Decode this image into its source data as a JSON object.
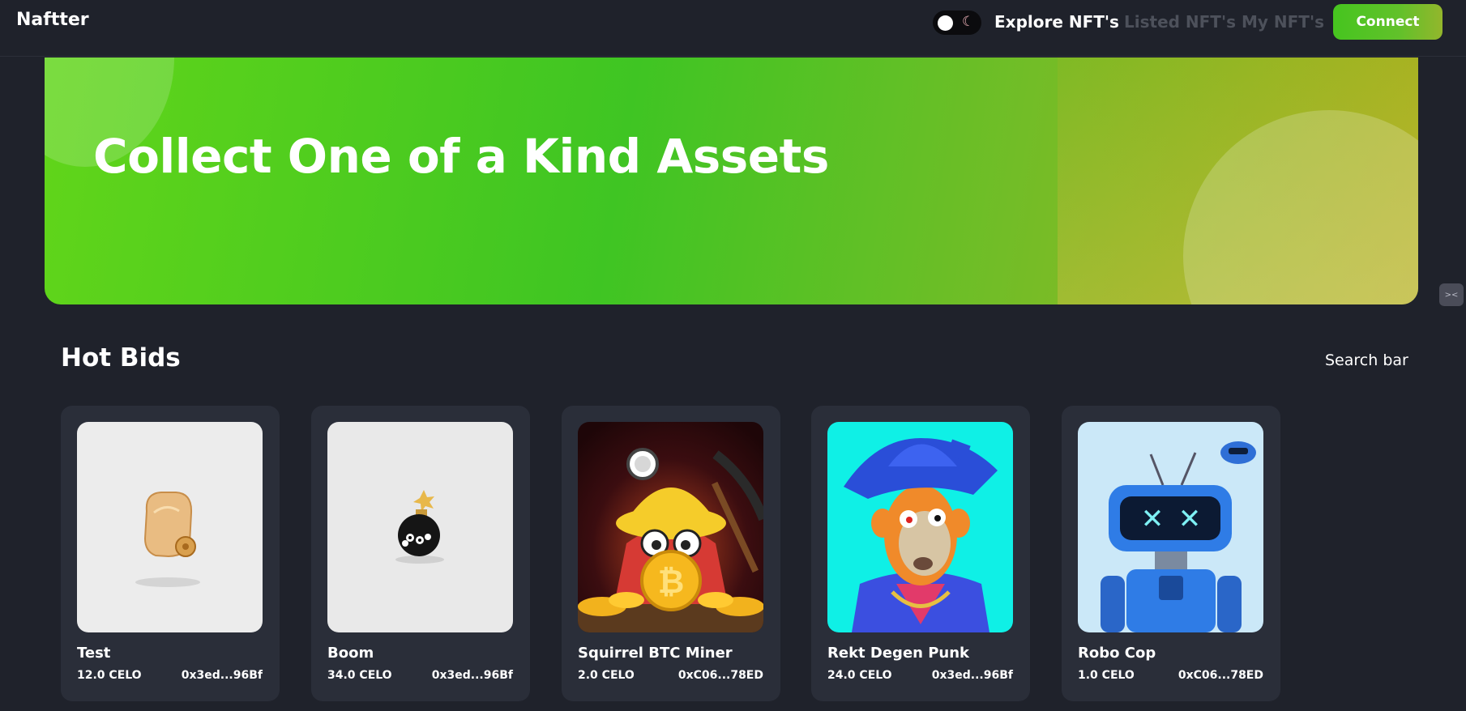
{
  "nav": {
    "brand": "Naftter",
    "toggle_icon": "moon-icon",
    "links": [
      "Explore NFT's",
      "Listed NFT's",
      "My NFT's"
    ],
    "connect_label": "Connect"
  },
  "hero": {
    "title": "Collect One of a Kind Assets"
  },
  "section": {
    "title": "Hot Bids",
    "search_label": "Search bar"
  },
  "cards": [
    {
      "name": "Test",
      "price": "12.0 CELO",
      "owner": "0x3ed...96Bf"
    },
    {
      "name": "Boom",
      "price": "34.0 CELO",
      "owner": "0x3ed...96Bf"
    },
    {
      "name": "Squirrel BTC Miner",
      "price": "2.0 CELO",
      "owner": "0xC06...78ED"
    },
    {
      "name": "Rekt Degen Punk",
      "price": "24.0 CELO",
      "owner": "0x3ed...96Bf"
    },
    {
      "name": "Robo Cop",
      "price": "1.0 CELO",
      "owner": "0xC06...78ED"
    }
  ],
  "colors": {
    "background": "#1f222b",
    "card": "#2a2e39",
    "accent_green": "#46c51f",
    "muted_link": "#4d515b"
  }
}
